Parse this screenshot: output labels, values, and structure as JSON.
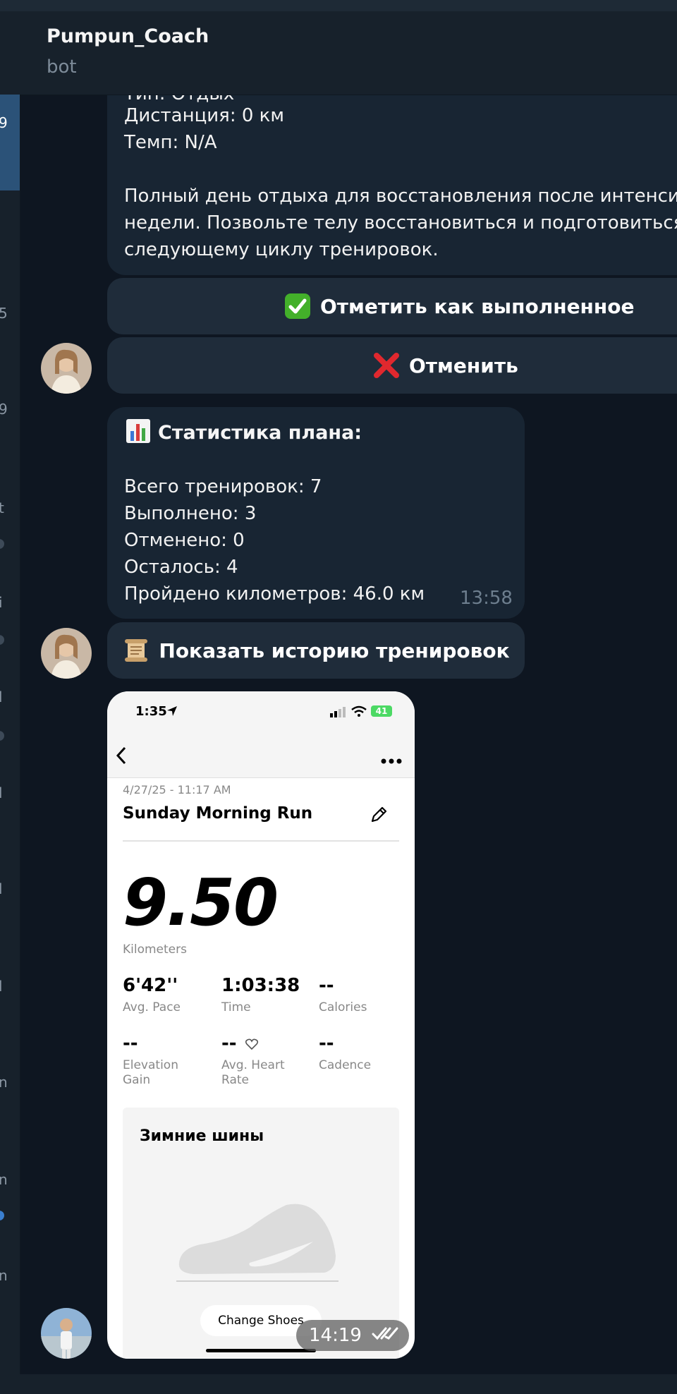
{
  "chat": {
    "title": "Pumpun_Coach",
    "subtitle": "bot"
  },
  "messages": {
    "workout": {
      "partial_line": "Тип: Отдых",
      "lines": [
        "Дистанция: 0 км",
        "Темп: N/A"
      ],
      "description": [
        "Полный день отдыха для восстановления после интенсив",
        "недели. Позвольте телу восстановиться и подготовиться",
        "следующему циклу тренировок."
      ]
    },
    "buttons": {
      "complete": "Отметить как выполненное",
      "cancel": "Отменить",
      "history": "Показать историю тренировок"
    },
    "stats": {
      "heading": "Статистика плана:",
      "lines": [
        "Всего тренировок: 7",
        "Выполнено: 3",
        "Отменено: 0",
        "Осталось: 4",
        "Пройдено километров: 46.0 км"
      ],
      "time": "13:58"
    },
    "photo": {
      "time": "14:19",
      "phone_time": "1:35",
      "battery": "41",
      "date": "4/27/25 - 11:17 AM",
      "run_title": "Sunday Morning Run",
      "distance": "9.50",
      "distance_unit": "Kilometers",
      "metrics": [
        {
          "value": "6'42''",
          "label": "Avg. Pace"
        },
        {
          "value": "1:03:38",
          "label": "Time"
        },
        {
          "value": "--",
          "label": "Calories"
        },
        {
          "value": "--",
          "label": "Elevation\nGain"
        },
        {
          "value": "--",
          "label": "Avg. Heart\nRate"
        },
        {
          "value": "--",
          "label": "Cadence"
        }
      ],
      "shoes_title": "Зимние шины",
      "change_shoes": "Change Shoes"
    }
  },
  "sidebar_fragments": [
    "9",
    "5",
    "9",
    "t",
    "i",
    "l",
    "l",
    "l",
    "l",
    "n",
    "n",
    "n"
  ],
  "colors": {
    "background": "#0e1621",
    "bubble": "#182533",
    "button": "#1f2c3a",
    "header": "#17212b",
    "accent_selected": "#2b5278"
  },
  "icons": [
    "check-mark-emoji-icon",
    "cross-mark-emoji-icon",
    "bar-chart-emoji-icon",
    "scroll-emoji-icon",
    "location-arrow-icon",
    "signal-icon",
    "wifi-icon",
    "battery-icon",
    "back-chevron-icon",
    "more-dots-icon",
    "pencil-icon",
    "heart-outline-icon",
    "shoe-icon",
    "read-receipt-double-check-icon"
  ]
}
